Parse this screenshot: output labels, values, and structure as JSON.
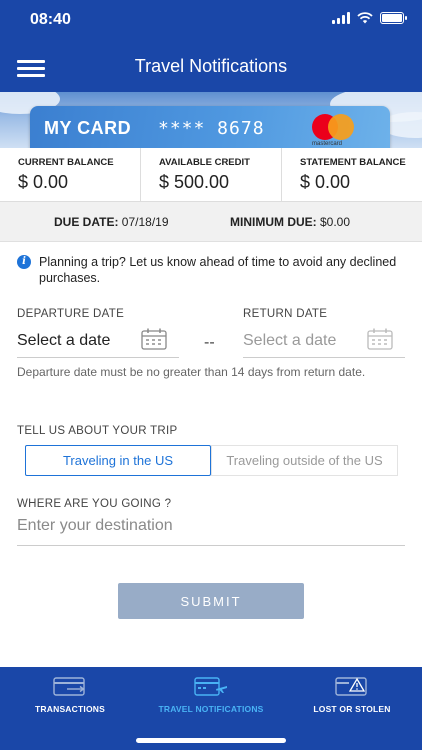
{
  "status_bar": {
    "time": "08:40"
  },
  "header": {
    "title": "Travel Notifications",
    "menu_icon": "hamburger-menu-icon"
  },
  "card": {
    "name": "MY CARD",
    "number": "**** 8678",
    "network": "mastercard"
  },
  "balances": [
    {
      "label": "CURRENT BALANCE",
      "value": "$ 0.00"
    },
    {
      "label": "AVAILABLE CREDIT",
      "value": "$ 500.00"
    },
    {
      "label": "STATEMENT BALANCE",
      "value": "$ 0.00"
    }
  ],
  "due": {
    "due_label": "DUE DATE:",
    "due_value": "07/18/19",
    "min_label": "MINIMUM DUE:",
    "min_value": "$0.00"
  },
  "info": {
    "icon": "info-icon",
    "text": "Planning a trip? Let us know ahead of time to avoid any declined purchases."
  },
  "departure": {
    "label": "DEPARTURE DATE",
    "value": "Select a date"
  },
  "return_date": {
    "label": "RETURN DATE",
    "placeholder": "Select a date"
  },
  "separator": "--",
  "hint": "Departure date must be no greater than 14 days from return date.",
  "trip": {
    "label": "TELL US ABOUT YOUR TRIP",
    "options": [
      {
        "label": "Traveling in the US",
        "selected": true
      },
      {
        "label": "Traveling outside of the US",
        "selected": false
      }
    ]
  },
  "destination": {
    "label": "WHERE ARE YOU GOING ?",
    "placeholder": "Enter your destination",
    "value": ""
  },
  "submit_label": "SUBMIT",
  "nav": [
    {
      "label": "TRANSACTIONS",
      "icon": "transactions-card-icon",
      "active": false
    },
    {
      "label": "TRAVEL NOTIFICATIONS",
      "icon": "travel-card-plane-icon",
      "active": true
    },
    {
      "label": "LOST OR STOLEN",
      "icon": "lost-card-warning-icon",
      "active": false
    }
  ],
  "colors": {
    "brand_blue": "#1a47a8",
    "accent_blue": "#1e73d8",
    "active_nav": "#49b3f5",
    "submit_disabled": "#98acc7"
  }
}
